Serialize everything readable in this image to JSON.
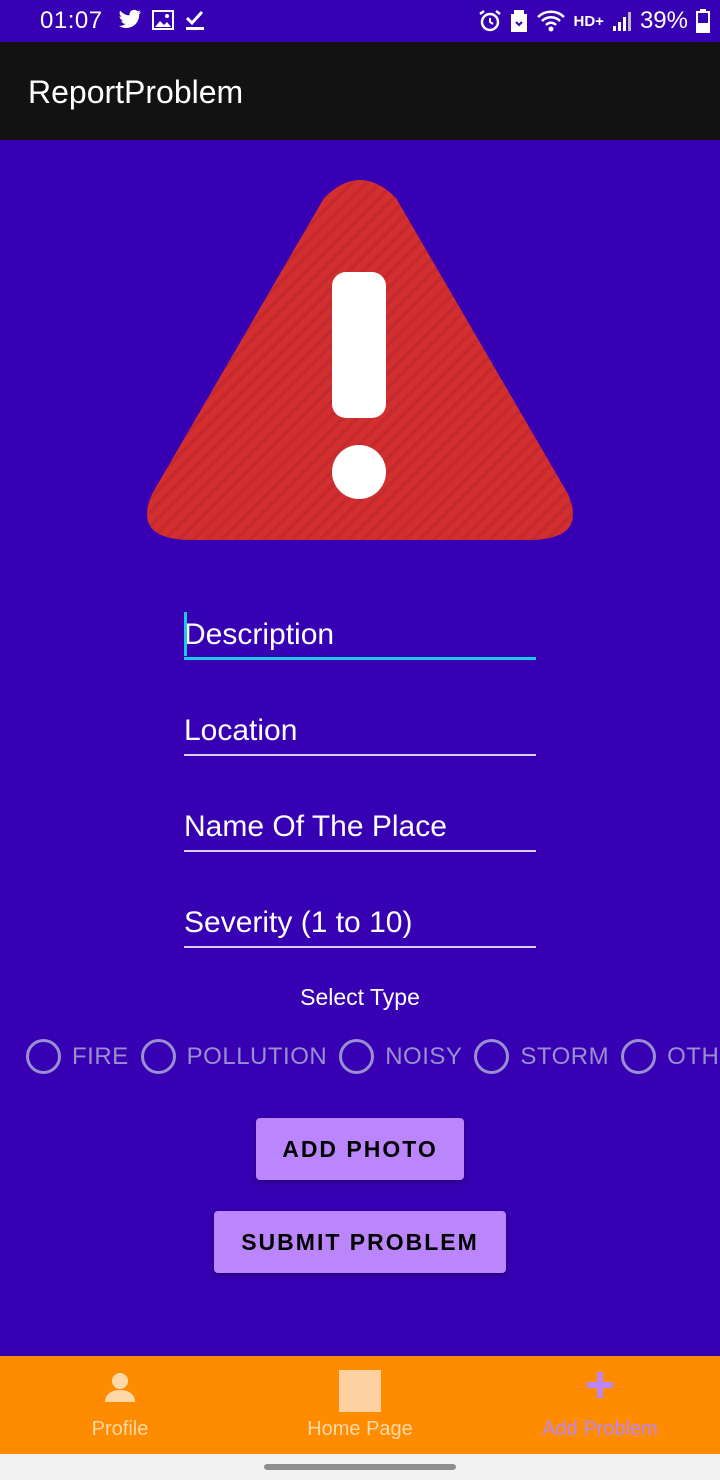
{
  "status_bar": {
    "time": "01:07",
    "network": "HD+",
    "battery": "39%",
    "left_icons": [
      "twitter-icon",
      "image-icon",
      "check-icon"
    ],
    "right_icons": [
      "alarm-icon",
      "save-icon",
      "wifi-icon",
      "signal-icon",
      "battery-icon"
    ]
  },
  "app_bar": {
    "title": "ReportProblem"
  },
  "warning": {
    "icon": "warning-triangle-icon",
    "color": "#D32F2F"
  },
  "form": {
    "description": {
      "placeholder": "Description",
      "value": ""
    },
    "location": {
      "placeholder": "Location",
      "value": ""
    },
    "place_name": {
      "placeholder": "Name Of The Place",
      "value": ""
    },
    "severity": {
      "placeholder": "Severity (1 to 10)",
      "value": ""
    },
    "select_type_label": "Select Type",
    "types": [
      "FIRE",
      "POLLUTION",
      "NOISY",
      "STORM",
      "OTHER"
    ],
    "add_photo_label": "ADD PHOTO",
    "submit_label": "SUBMIT PROBLEM"
  },
  "bottom_nav": {
    "items": [
      {
        "label": "Profile",
        "icon": "person-icon"
      },
      {
        "label": "Home Page",
        "icon": "home-square-icon"
      },
      {
        "label": "Add Problem",
        "icon": "plus-icon",
        "selected": true
      }
    ]
  },
  "colors": {
    "background": "#3700B3",
    "app_bar": "#121212",
    "accent": "#BB86FC",
    "bottom_nav": "#FF8C00",
    "focus": "#1EC6E8"
  }
}
